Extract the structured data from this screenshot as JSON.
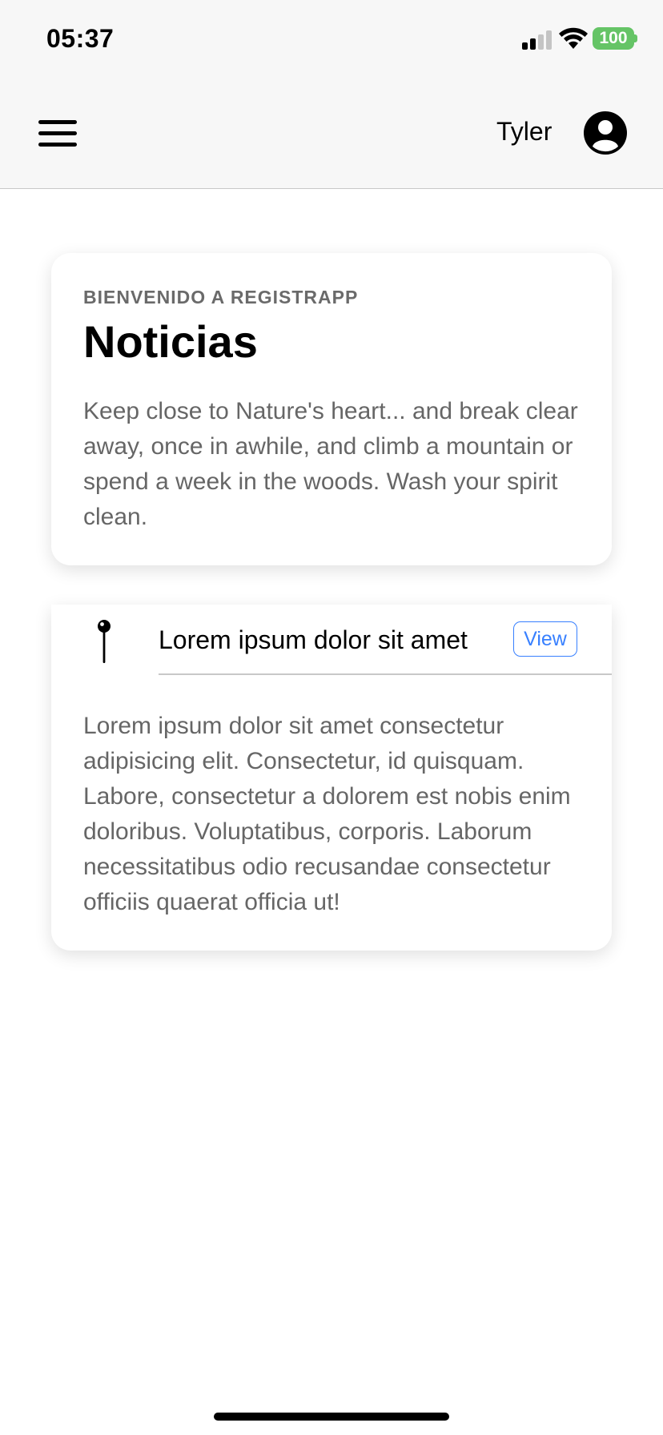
{
  "status_bar": {
    "time": "05:37",
    "battery": "100",
    "signal_icon": "cellular-signal-icon",
    "wifi_icon": "wifi-icon",
    "battery_color": "#65c466"
  },
  "toolbar": {
    "menu_icon": "hamburger-menu-icon",
    "user_name": "Tyler",
    "avatar_icon": "user-circle-icon"
  },
  "welcome_card": {
    "subtitle": "BIENVENIDO A REGISTRAPP",
    "title": "Noticias",
    "body": "Keep close to Nature's heart... and break clear away, once in awhile, and climb a mountain or spend a week in the woods. Wash your spirit clean."
  },
  "news_card": {
    "item_icon": "pin-icon",
    "item_title": "Lorem ipsum dolor sit amet",
    "view_label": "View",
    "accent_color": "#3880ff",
    "body": "Lorem ipsum dolor sit amet consectetur adipisicing elit. Consectetur, id quisquam. Labore, consectetur a dolorem est nobis enim doloribus. Voluptatibus, corporis. Laborum necessitatibus odio recusandae consectetur officiis quaerat officia ut!"
  }
}
